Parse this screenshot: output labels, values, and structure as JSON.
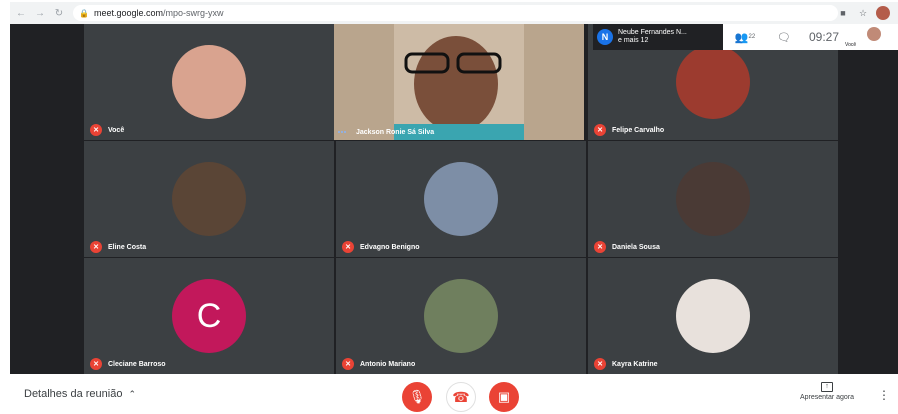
{
  "browser": {
    "url_host": "meet.google.com",
    "url_path": "/mpo-swrg-yxw"
  },
  "header": {
    "presenter_initial": "N",
    "presenter_line1": "Neube Fernandes N...",
    "presenter_line2": "e mais 12",
    "people_count": "22",
    "clock": "09:27",
    "self_label": "Você"
  },
  "participants": [
    {
      "name": "Você",
      "mic_muted": true
    },
    {
      "name": "Jackson Ronie Sá Silva",
      "mic_muted": false,
      "video_on": true
    },
    {
      "name": "Felipe Carvalho",
      "mic_muted": true
    },
    {
      "name": "Eline Costa",
      "mic_muted": true
    },
    {
      "name": "Edvagno Benigno",
      "mic_muted": true
    },
    {
      "name": "Daniela Sousa",
      "mic_muted": true
    },
    {
      "name": "Cleciane Barroso",
      "mic_muted": true,
      "avatar_letter": "C"
    },
    {
      "name": "Antonio Mariano",
      "mic_muted": true
    },
    {
      "name": "Kayra Katrine",
      "mic_muted": true
    }
  ],
  "footer": {
    "details_label": "Detalhes da reunião",
    "present_label": "Apresentar agora"
  },
  "colors": {
    "meet_bg": "#202124",
    "tile_bg": "#3c4043",
    "mute_red": "#ea4335",
    "letter_avatar": "#c2185b",
    "presenter_blue": "#1a73e8"
  }
}
